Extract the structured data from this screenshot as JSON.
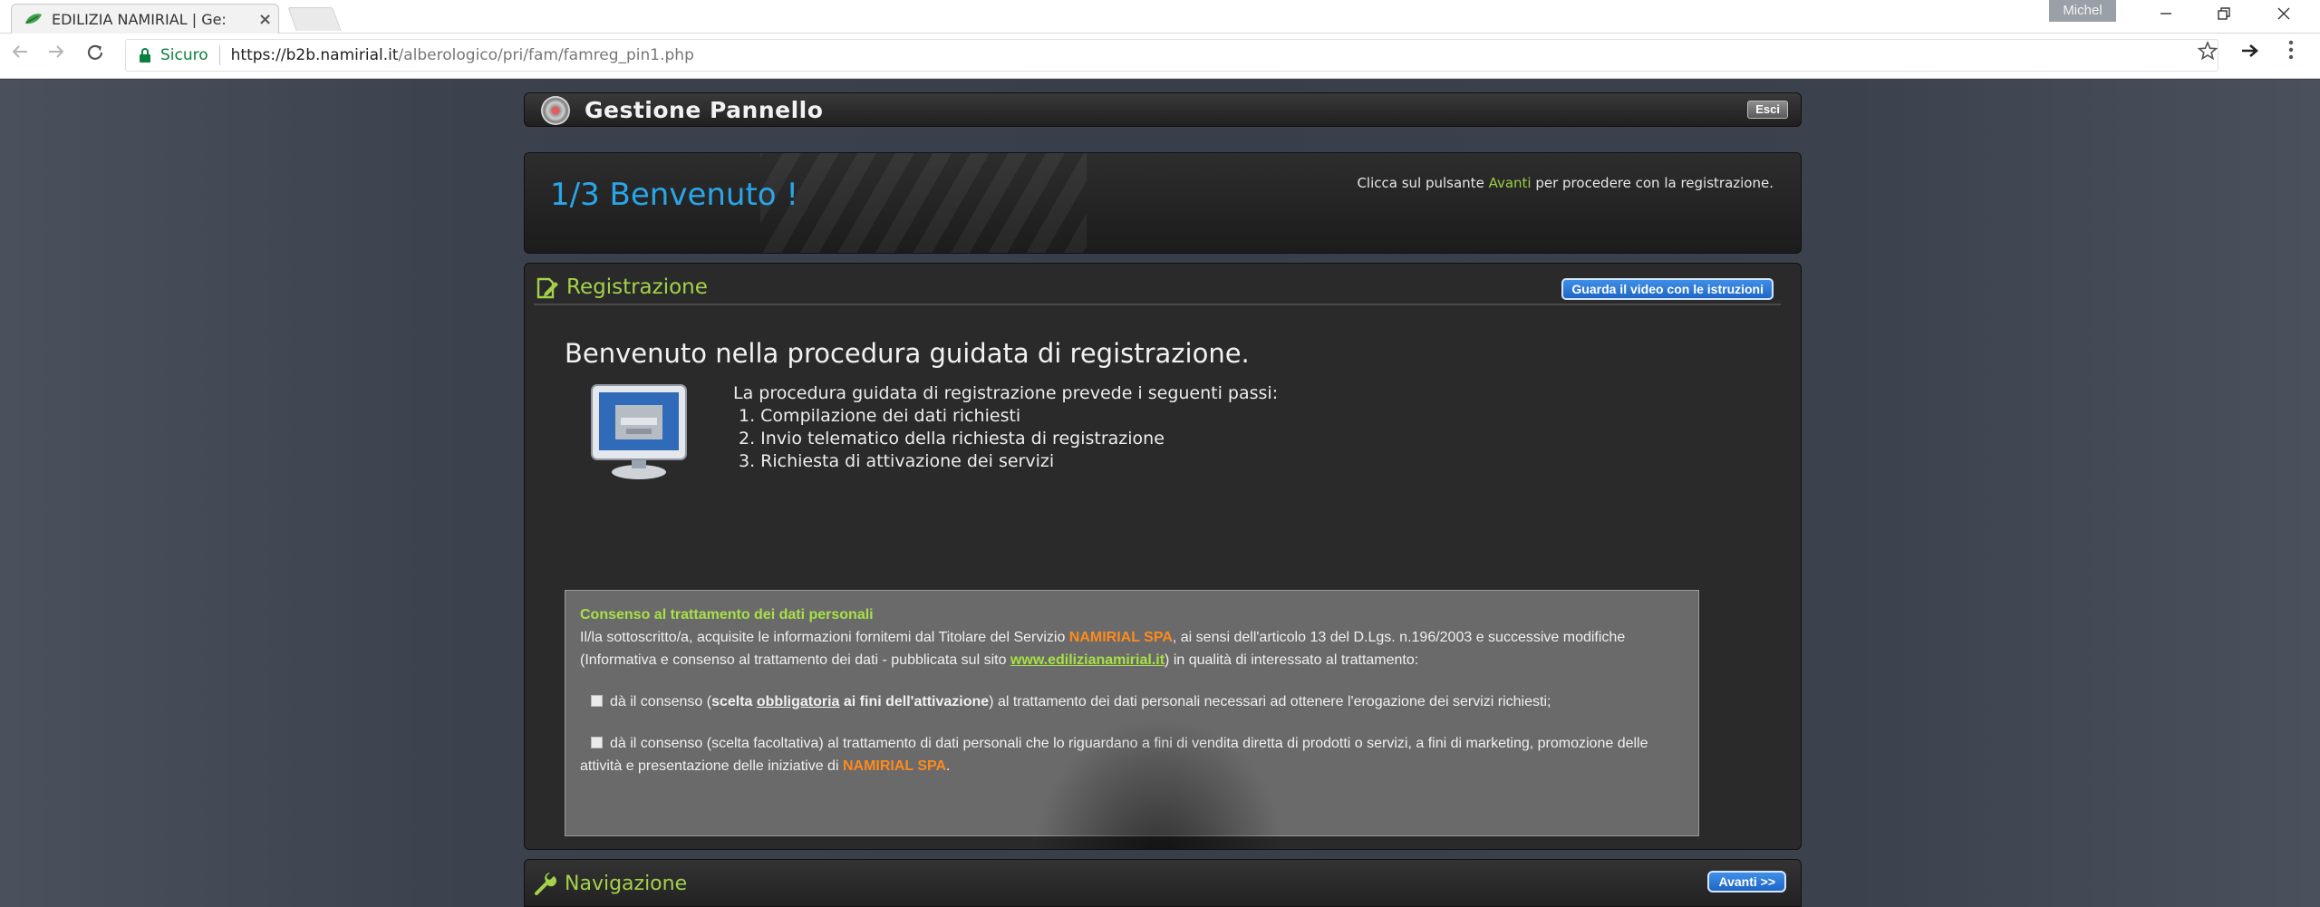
{
  "browser": {
    "tab_title": "EDILIZIA NAMIRIAL | Ge:",
    "tab_close": "×",
    "user_name": "Michel",
    "security_label": "Sicuro",
    "url_host": "https://b2b.namirial.it",
    "url_path": "/alberologico/pri/fam/famreg_pin1.php"
  },
  "header": {
    "title": "Gestione Pannello",
    "logout_label": "Esci"
  },
  "welcome": {
    "title": "1/3 Benvenuto !",
    "note_before": "Clicca sul pulsante ",
    "note_highlight": "Avanti",
    "note_after": " per procedere con la registrazione."
  },
  "registration": {
    "title": "Registrazione",
    "video_button": "Guarda il video con le istruzioni",
    "heading": "Benvenuto nella procedura guidata di registrazione.",
    "steps_intro": "La procedura guidata di registrazione prevede i seguenti passi:",
    "steps": [
      "1. Compilazione dei dati richiesti",
      "2. Invio telematico della richiesta di registrazione",
      "3. Richiesta di attivazione dei servizi"
    ]
  },
  "consent": {
    "title": "Consenso al trattamento dei dati personali",
    "text_1": "Il/la sottoscritto/a, acquisite le informazioni fornitemi dal Titolare del Servizio ",
    "company": "NAMIRIAL SPA",
    "text_2": ", ai sensi dell'articolo 13 del D.Lgs. n.196/2003 e successive modifiche (Informativa e consenso al trattamento dei dati - pubblicata sul sito ",
    "site_link": "www.edilizianamirial.it",
    "text_3": ") in qualità di interessato al trattamento:",
    "option1_a": "dà il consenso (",
    "option1_b": "scelta ",
    "option1_c": "obbligatoria",
    "option1_d": " ai fini dell'attivazione",
    "option1_e": ") al trattamento dei dati personali necessari ad ottenere l'erogazione dei servizi richiesti;",
    "option2_a": "dà il consenso (scelta facoltativa) al trattamento di dati personali che lo riguardano a fini di vendita diretta di prodotti o servizi, a fini di marketing, promozione delle attività e presentazione delle iniziative di ",
    "option2_company": "NAMIRIAL SPA",
    "option2_end": "."
  },
  "navigation": {
    "title": "Navigazione",
    "next_button": "Avanti >>"
  },
  "colors": {
    "accent_blue": "#2aa6e8",
    "accent_green": "#a4d14a",
    "brand_orange": "#ff8a1c",
    "button_blue": "#1f66c5"
  },
  "icons": {
    "tab_favicon": "leaf-icon",
    "back": "back-arrow-icon",
    "forward": "forward-arrow-icon",
    "reload": "reload-icon",
    "lock": "lock-icon",
    "bookmark": "star-icon",
    "extension": "extension-arrow-icon",
    "menu": "kebab-menu-icon",
    "header_logo": "target-logo-icon",
    "registration": "edit-document-icon",
    "monitor": "monitor-icon",
    "navigation": "wrench-icon"
  }
}
